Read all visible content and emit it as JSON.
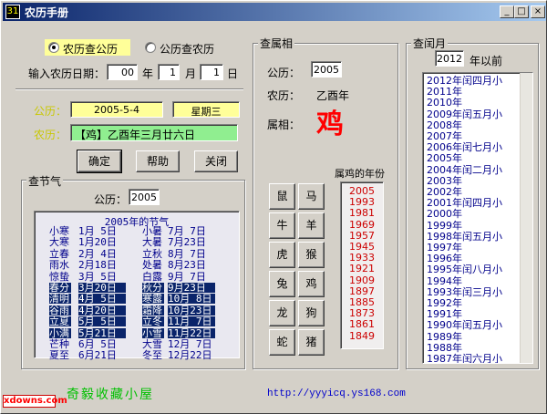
{
  "window": {
    "title": "农历手册",
    "app_icon_text": "31"
  },
  "mode": {
    "option1": "农历查公历",
    "option2": "公历查农历",
    "selected": "option1"
  },
  "input": {
    "label": "输入农历日期：",
    "year_value": "00",
    "year_unit": "年",
    "month_value": "1",
    "month_unit": "月",
    "day_value": "1",
    "day_unit": "日"
  },
  "result": {
    "gregorian_label": "公历：",
    "gregorian_value": "2005-5-4",
    "weekday_value": "星期三",
    "lunar_label": "农历：",
    "lunar_value": "【鸡】乙酉年三月廿六日"
  },
  "buttons": {
    "ok": "确定",
    "help": "帮助",
    "close": "关闭"
  },
  "solar_terms": {
    "group_title": "查节气",
    "year_label": "公历：",
    "year_value": "2005",
    "list_title": "2005年的节气",
    "rows": [
      {
        "n1": "小寒",
        "d1": "1月 5日",
        "n2": "小暑",
        "d2": "7月 7日",
        "hl": false
      },
      {
        "n1": "大寒",
        "d1": "1月20日",
        "n2": "大暑",
        "d2": "7月23日",
        "hl": false
      },
      {
        "n1": "立春",
        "d1": "2月 4日",
        "n2": "立秋",
        "d2": "8月 7日",
        "hl": false
      },
      {
        "n1": "雨水",
        "d1": "2月18日",
        "n2": "处暑",
        "d2": "8月23日",
        "hl": false
      },
      {
        "n1": "惊蛰",
        "d1": "3月 5日",
        "n2": "白露",
        "d2": "9月 7日",
        "hl": false
      },
      {
        "n1": "春分",
        "d1": "3月20日",
        "n2": "秋分",
        "d2": "9月23日",
        "hl": true
      },
      {
        "n1": "清明",
        "d1": "4月 5日",
        "n2": "寒露",
        "d2": "10月 8日",
        "hl": true
      },
      {
        "n1": "谷雨",
        "d1": "4月20日",
        "n2": "霜降",
        "d2": "10月23日",
        "hl": true
      },
      {
        "n1": "立夏",
        "d1": "5月 5日",
        "n2": "立冬",
        "d2": "11月 7日",
        "hl": true
      },
      {
        "n1": "小满",
        "d1": "5月21日",
        "n2": "小雪",
        "d2": "11月22日",
        "hl": true
      },
      {
        "n1": "芒种",
        "d1": "6月 5日",
        "n2": "大雪",
        "d2": "12月 7日",
        "hl": false
      },
      {
        "n1": "夏至",
        "d1": "6月21日",
        "n2": "冬至",
        "d2": "12月22日",
        "hl": false
      }
    ]
  },
  "zodiac": {
    "group_title": "查属相",
    "gregorian_label": "公历：",
    "year_value": "2005",
    "lunar_label": "农历：",
    "lunar_value": "乙酉年",
    "sign_label": "属相：",
    "sign_value": "鸡",
    "animals": [
      "鼠",
      "马",
      "牛",
      "羊",
      "虎",
      "猴",
      "兔",
      "鸡",
      "龙",
      "狗",
      "蛇",
      "猪"
    ],
    "years_title": "属鸡的年份",
    "years": [
      "2005",
      "1993",
      "1981",
      "1969",
      "1957",
      "1945",
      "1933",
      "1921",
      "1909",
      "1897",
      "1885",
      "1873",
      "1861",
      "1849"
    ]
  },
  "leap_month": {
    "group_title": "查闰月",
    "year_value": "2012",
    "suffix": "年以前",
    "items": [
      "2012年闰四月小",
      "2011年",
      "2010年",
      "2009年闰五月小",
      "2008年",
      "2007年",
      "2006年闰七月小",
      "2005年",
      "2004年闰二月小",
      "2003年",
      "2002年",
      "2001年闰四月小",
      "2000年",
      "1999年",
      "1998年闰五月小",
      "1997年",
      "1996年",
      "1995年闰八月小",
      "1994年",
      "1993年闰三月小",
      "1992年",
      "1991年",
      "1990年闰五月小",
      "1989年",
      "1988年",
      "1987年闰六月小"
    ]
  },
  "footer": {
    "watermark": "xdowns.com",
    "signature": "奇毅收藏小屋",
    "url": "http://yyyicq.ys168.com"
  },
  "colors": {
    "title_bar": "#0a246a",
    "highlight_yellow": "#ffff99",
    "highlight_green": "#90ee90",
    "label_yellow": "#c8c800",
    "zodiac_red": "#ff0000",
    "navy": "#00008b"
  }
}
